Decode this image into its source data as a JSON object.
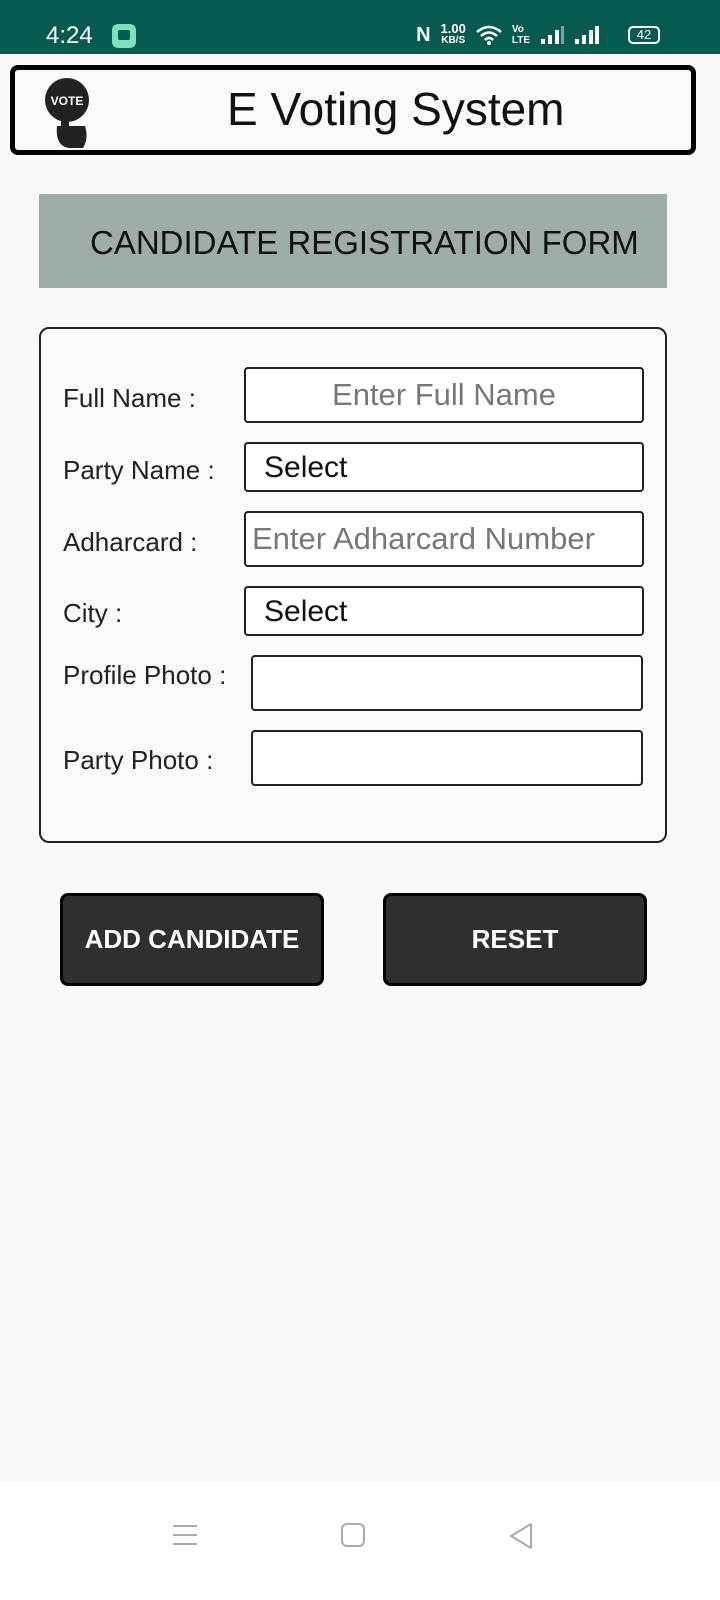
{
  "status_bar": {
    "time": "4:24",
    "network_speed_value": "1.00",
    "network_speed_unit": "KB/S",
    "volte_top": "Vo",
    "volte_bottom": "LTE",
    "battery": "42"
  },
  "header": {
    "logo_text": "VOTE",
    "app_title": "E Voting System"
  },
  "form": {
    "title": "CANDIDATE REGISTRATION FORM",
    "fields": {
      "full_name": {
        "label": "Full Name :",
        "placeholder": "Enter Full Name"
      },
      "party_name": {
        "label": "Party Name :",
        "selected": "Select"
      },
      "adharcard": {
        "label": "Adharcard :",
        "placeholder": "Enter Adharcard Number"
      },
      "city": {
        "label": "City :",
        "selected": "Select"
      },
      "profile_photo": {
        "label": "Profile Photo :"
      },
      "party_photo": {
        "label": "Party Photo :"
      }
    }
  },
  "actions": {
    "add_label": "ADD CANDIDATE",
    "reset_label": "RESET"
  },
  "nav_bar": {
    "icons": [
      "menu-icon",
      "home-icon",
      "back-icon"
    ]
  },
  "colors": {
    "status_bar": "#075a50",
    "title_bar": "#9eadaa",
    "button": "#2c312f",
    "background": "#f9f9f9"
  }
}
